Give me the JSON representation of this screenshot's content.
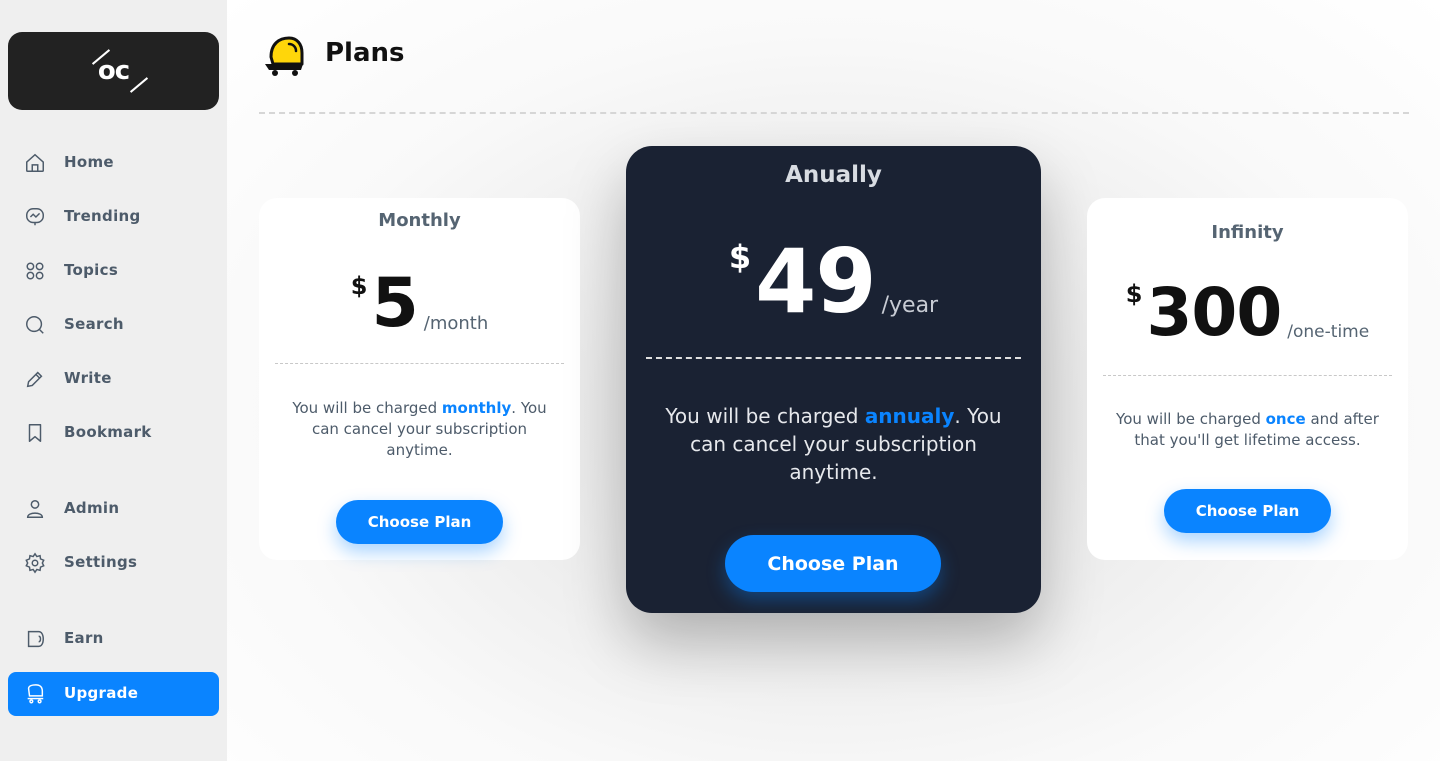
{
  "sidebar": {
    "logo": "oc",
    "items": [
      {
        "label": "Home",
        "icon": "home-icon"
      },
      {
        "label": "Trending",
        "icon": "trending-icon"
      },
      {
        "label": "Topics",
        "icon": "grid-icon"
      },
      {
        "label": "Search",
        "icon": "search-icon"
      },
      {
        "label": "Write",
        "icon": "pencil-icon"
      },
      {
        "label": "Bookmark",
        "icon": "bookmark-icon"
      },
      {
        "label": "Admin",
        "icon": "user-icon"
      },
      {
        "label": "Settings",
        "icon": "gear-icon"
      },
      {
        "label": "Earn",
        "icon": "wallet-icon"
      },
      {
        "label": "Upgrade",
        "icon": "cart-icon",
        "active": true
      }
    ]
  },
  "header": {
    "title": "Plans",
    "icon": "shopping-cart-icon"
  },
  "plans": {
    "monthly": {
      "title": "Monthly",
      "currency": "$",
      "amount": "5",
      "period": "/month",
      "desc_pre": "You will be charged ",
      "desc_highlight": "monthly",
      "desc_post": ". You can cancel your subscription anytime.",
      "button": "Choose Plan"
    },
    "annual": {
      "title": "Anually",
      "currency": "$",
      "amount": "49",
      "period": "/year",
      "desc_pre": "You will be charged ",
      "desc_highlight": "annualy",
      "desc_post": ". You can cancel your subscription anytime.",
      "button": "Choose Plan"
    },
    "infinity": {
      "title": "Infinity",
      "currency": "$",
      "amount": "300",
      "period": "/one-time",
      "desc_pre": "You will be charged ",
      "desc_highlight": "once",
      "desc_post": " and after that you'll get lifetime access.",
      "button": "Choose Plan"
    }
  },
  "colors": {
    "accent": "#0a84ff",
    "dark_card": "#1a2233",
    "logo_bg": "#222222",
    "icon_yellow": "#ffd60a"
  }
}
